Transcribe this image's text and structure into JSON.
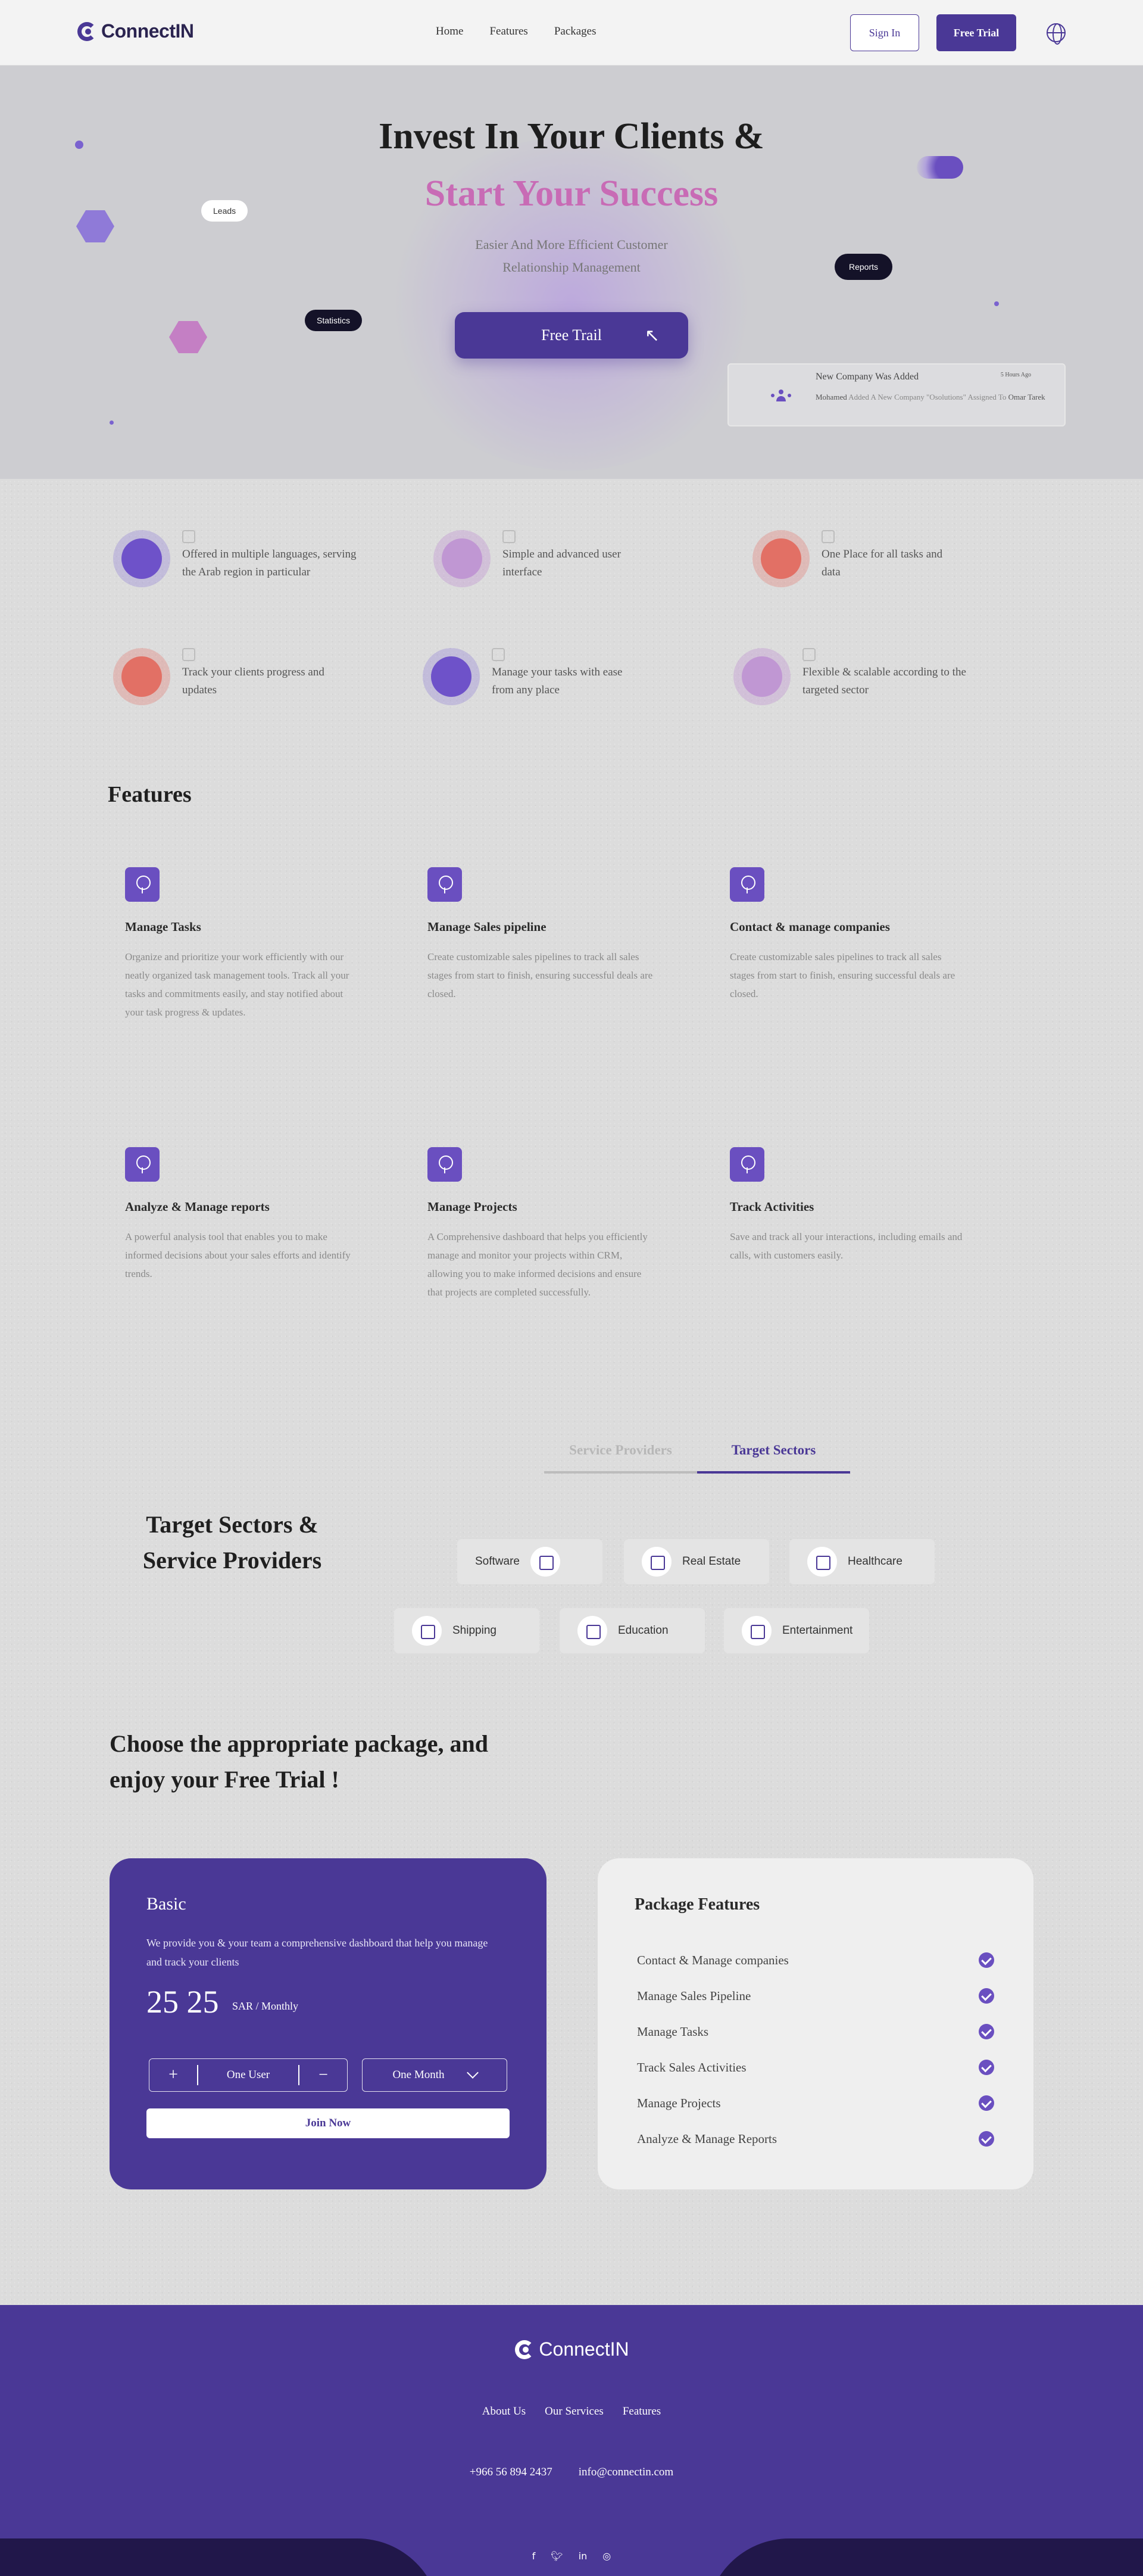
{
  "nav": {
    "brand": "ConnectIN",
    "links": [
      "Home",
      "Features",
      "Packages"
    ],
    "sign_in": "Sign In",
    "free_trial": "Free Trial"
  },
  "hero": {
    "title_line1": "Invest In Your Clients &",
    "title_line2": "Start Your Success",
    "subtitle": "Easier And More Efficient Customer Relationship Management",
    "cta": "Free Trail",
    "bubbles": {
      "leads": "Leads",
      "statistics": "Statistics",
      "reports": "Reports"
    },
    "notice": {
      "title": "New Company Was Added",
      "time": "5 Hours Ago",
      "actor": "Mohamed",
      "text_mid": " Added A New Company \"Osolutions\" Assigned To ",
      "assignee": "Omar Tarek"
    },
    "colors": {
      "accent": "#4a3896",
      "highlight": "#c86bb5"
    }
  },
  "benefits": [
    {
      "text": "Offered in multiple languages, serving the Arab region in particular",
      "color": "purple"
    },
    {
      "text": "Simple and advanced user interface",
      "color": "pink"
    },
    {
      "text": "One Place for all tasks and data",
      "color": "red"
    },
    {
      "text": "Track your clients progress and updates",
      "color": "red"
    },
    {
      "text": "Manage your tasks with ease from any place",
      "color": "purple"
    },
    {
      "text": "Flexible & scalable according to the targeted sector",
      "color": "pink"
    }
  ],
  "features": {
    "title": "Features",
    "items": [
      {
        "title": "Manage Tasks",
        "desc": "Organize and prioritize your work efficiently with our neatly organized task management tools. Track all your tasks and commitments easily, and stay notified about your task progress & updates."
      },
      {
        "title": "Manage Sales pipeline",
        "desc": "Create customizable sales pipelines to track all sales stages from start to finish, ensuring successful deals are closed."
      },
      {
        "title": "Contact & manage companies",
        "desc": "Create customizable sales pipelines to track all sales stages from start to finish, ensuring successful deals are closed."
      },
      {
        "title": "Analyze & Manage reports",
        "desc": "A powerful analysis tool that enables you to make informed decisions about your sales efforts and identify trends."
      },
      {
        "title": "Manage Projects",
        "desc": "A Comprehensive dashboard that helps you efficiently manage and monitor your projects within CRM, allowing you to make informed decisions and ensure that projects are completed successfully."
      },
      {
        "title": "Track Activities",
        "desc": "Save and track all your interactions, including emails and calls, with customers easily."
      }
    ]
  },
  "sectors": {
    "tabs": [
      "Service Providers",
      "Target Sectors"
    ],
    "title": "Target Sectors & Service Providers",
    "chips": [
      "Software",
      "Real Estate",
      "Healthcare",
      "Shipping",
      "Education",
      "Entertainment"
    ]
  },
  "packages": {
    "title": "Choose the appropriate package, and enjoy your Free Trial !",
    "basic": {
      "name": "Basic",
      "desc": "We provide you & your team a comprehensive dashboard that help you manage and track your clients",
      "price": "25 25",
      "unit": "SAR / Monthly",
      "users_value": "One User",
      "plus": "+",
      "minus": "−",
      "period_value": "One Month",
      "join": "Join Now"
    },
    "features_card": {
      "title": "Package Features",
      "items": [
        "Contact & Manage companies",
        "Manage Sales Pipeline",
        "Manage Tasks",
        "Track Sales Activities",
        "Manage Projects",
        "Analyze & Manage Reports"
      ]
    }
  },
  "footer": {
    "brand": "ConnectIN",
    "links": [
      "About Us",
      "Our Services",
      "Features"
    ],
    "phone": "+966 56 894 2437",
    "email": "info@connectin.com",
    "social": [
      "f",
      "t",
      "in",
      "ig"
    ]
  }
}
